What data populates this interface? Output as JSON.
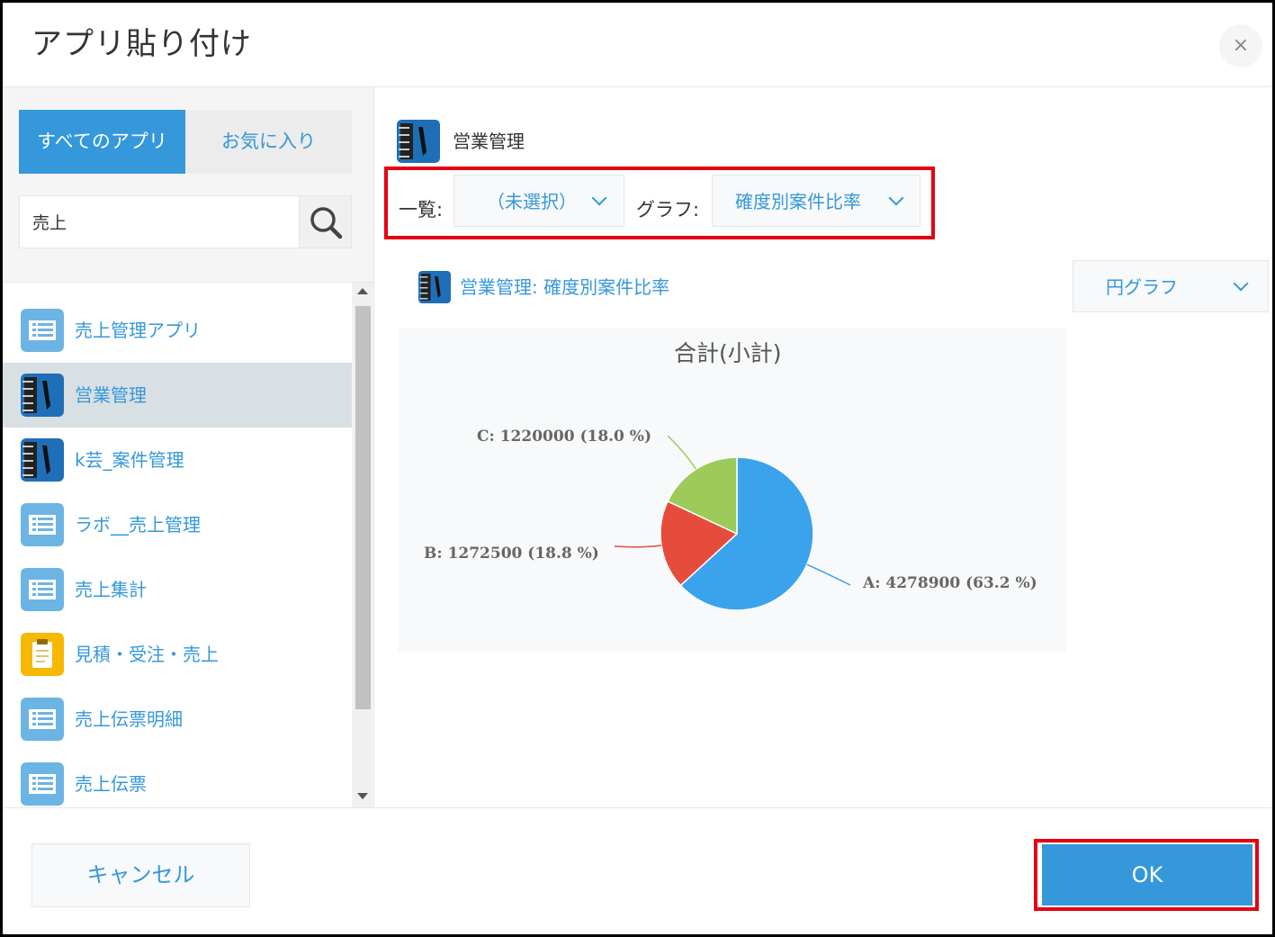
{
  "dialog": {
    "title": "アプリ貼り付け",
    "close_label": "×"
  },
  "tabs": {
    "all": "すべてのアプリ",
    "favorites": "お気に入り"
  },
  "search": {
    "value": "売上"
  },
  "apps": [
    {
      "label": "売上管理アプリ",
      "icon": "list-app-icon",
      "selected": false
    },
    {
      "label": "営業管理",
      "icon": "notebook-app-icon",
      "selected": true
    },
    {
      "label": "k芸_案件管理",
      "icon": "notebook-app-icon",
      "selected": false
    },
    {
      "label": "ラボ__売上管理",
      "icon": "list-app-icon",
      "selected": false
    },
    {
      "label": "売上集計",
      "icon": "list-app-icon",
      "selected": false
    },
    {
      "label": "見積・受注・売上",
      "icon": "clipboard-app-icon",
      "selected": false
    },
    {
      "label": "売上伝票明細",
      "icon": "list-app-icon",
      "selected": false
    },
    {
      "label": "売上伝票",
      "icon": "list-app-icon",
      "selected": false
    }
  ],
  "selected_app": {
    "name": "営業管理"
  },
  "selectors": {
    "view_label": "一覧:",
    "view_value": "（未選択）",
    "graph_label": "グラフ:",
    "graph_value": "確度別案件比率"
  },
  "report": {
    "title": "営業管理: 確度別案件比率",
    "chart_type_value": "円グラフ"
  },
  "chart_data": {
    "type": "pie",
    "title": "合計(小計)",
    "slices": [
      {
        "name": "A",
        "value": 4278900,
        "percent": 63.2,
        "label": "A: 4278900 (63.2 %)",
        "color": "#3ba3ec"
      },
      {
        "name": "B",
        "value": 1272500,
        "percent": 18.8,
        "label": "B: 1272500 (18.8 %)",
        "color": "#e54c3c"
      },
      {
        "name": "C",
        "value": 1220000,
        "percent": 18.0,
        "label": "C: 1220000 (18.0 %)",
        "color": "#9ccb5a"
      }
    ]
  },
  "footer": {
    "cancel_label": "キャンセル",
    "ok_label": "OK"
  },
  "colors": {
    "accent": "#3498db",
    "highlight": "#e60012"
  }
}
